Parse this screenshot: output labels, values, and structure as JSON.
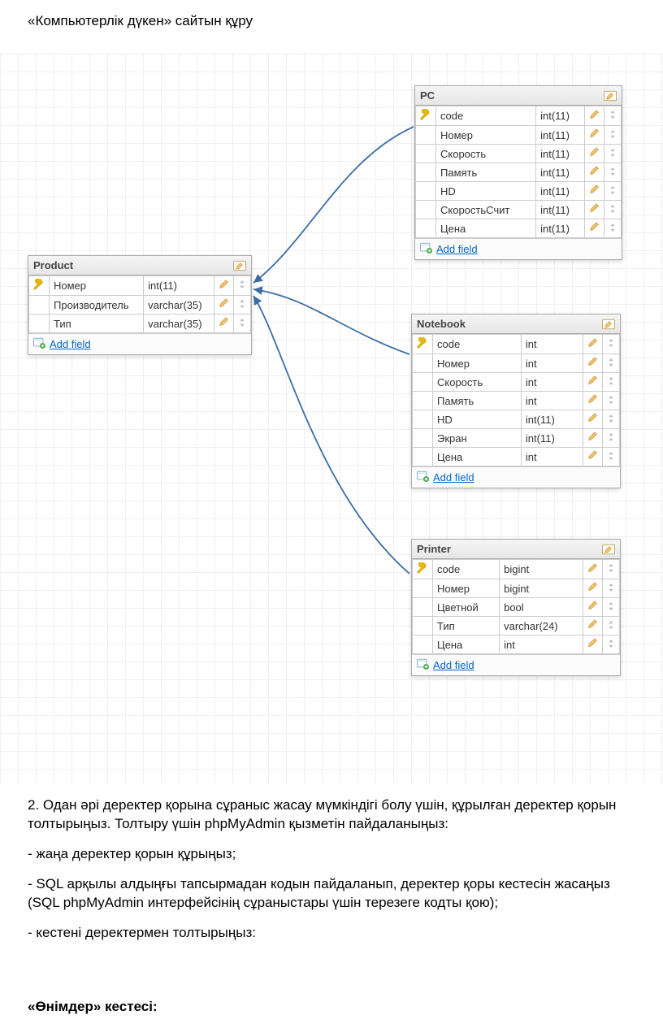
{
  "document": {
    "title": "«Компьютерлік дүкен» сайтын құру",
    "paragraphs": [
      "2. Одан әрі деректер қорына сұраныс жасау мүмкіндігі болу үшін, құрылған деректер қорын толтырыңыз. Толтыру үшін phpMyAdmin қызметін пайдаланыңыз:",
      "- жаңа деректер қорын құрыңыз;",
      "- SQL арқылы алдыңғы тапсырмадан кодын пайдаланып, деректер қоры кестесін жасаңыз (SQL phpMyAdmin интерфейсінің сұраныстары үшін терезеге кодты қою);",
      "- кестені деректермен толтырыңыз:"
    ],
    "footer_heading": "«Өнімдер» кестесі:"
  },
  "add_field_label": "Add field",
  "tables": {
    "product": {
      "name": "Product",
      "fields": [
        {
          "key": true,
          "name": "Номер",
          "type": "int(11)"
        },
        {
          "key": false,
          "name": "Производитель",
          "type": "varchar(35)"
        },
        {
          "key": false,
          "name": "Тип",
          "type": "varchar(35)"
        }
      ]
    },
    "pc": {
      "name": "PC",
      "fields": [
        {
          "key": true,
          "name": "code",
          "type": "int(11)"
        },
        {
          "key": false,
          "name": "Номер",
          "type": "int(11)"
        },
        {
          "key": false,
          "name": "Скорость",
          "type": "int(11)"
        },
        {
          "key": false,
          "name": "Память",
          "type": "int(11)"
        },
        {
          "key": false,
          "name": "HD",
          "type": "int(11)"
        },
        {
          "key": false,
          "name": "СкоростьСчит",
          "type": "int(11)"
        },
        {
          "key": false,
          "name": "Цена",
          "type": "int(11)"
        }
      ]
    },
    "notebook": {
      "name": "Notebook",
      "fields": [
        {
          "key": true,
          "name": "code",
          "type": "int"
        },
        {
          "key": false,
          "name": "Номер",
          "type": "int"
        },
        {
          "key": false,
          "name": "Скорость",
          "type": "int"
        },
        {
          "key": false,
          "name": "Память",
          "type": "int"
        },
        {
          "key": false,
          "name": "HD",
          "type": "int(11)"
        },
        {
          "key": false,
          "name": "Экран",
          "type": "int(11)"
        },
        {
          "key": false,
          "name": "Цена",
          "type": "int"
        }
      ]
    },
    "printer": {
      "name": "Printer",
      "fields": [
        {
          "key": true,
          "name": "code",
          "type": "bigint"
        },
        {
          "key": false,
          "name": "Номер",
          "type": "bigint"
        },
        {
          "key": false,
          "name": "Цветной",
          "type": "bool"
        },
        {
          "key": false,
          "name": "Тип",
          "type": "varchar(24)"
        },
        {
          "key": false,
          "name": "Цена",
          "type": "int"
        }
      ]
    }
  }
}
